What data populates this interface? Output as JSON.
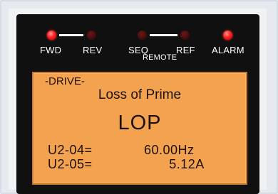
{
  "indicators": {
    "fwd": {
      "label": "FWD",
      "state": "on"
    },
    "rev": {
      "label": "REV",
      "state": "off"
    },
    "seq": {
      "label": "SEQ",
      "state": "off"
    },
    "ref": {
      "label": "REF",
      "state": "off"
    },
    "remote_label": "REMOTE",
    "alarm": {
      "label": "ALARM",
      "state": "on"
    }
  },
  "display": {
    "mode": "-DRIVE-",
    "fault_name": "Loss of Prime",
    "fault_code": "LOP",
    "monitors": [
      {
        "label": "U2-04=",
        "value": "60.00Hz"
      },
      {
        "label": "U2-05=",
        "value": "5.12A"
      }
    ]
  },
  "colors": {
    "led_on": "#ff2020",
    "led_off": "#3e0a0a",
    "lcd_background": "#f3a34f",
    "panel_background": "#101010"
  }
}
